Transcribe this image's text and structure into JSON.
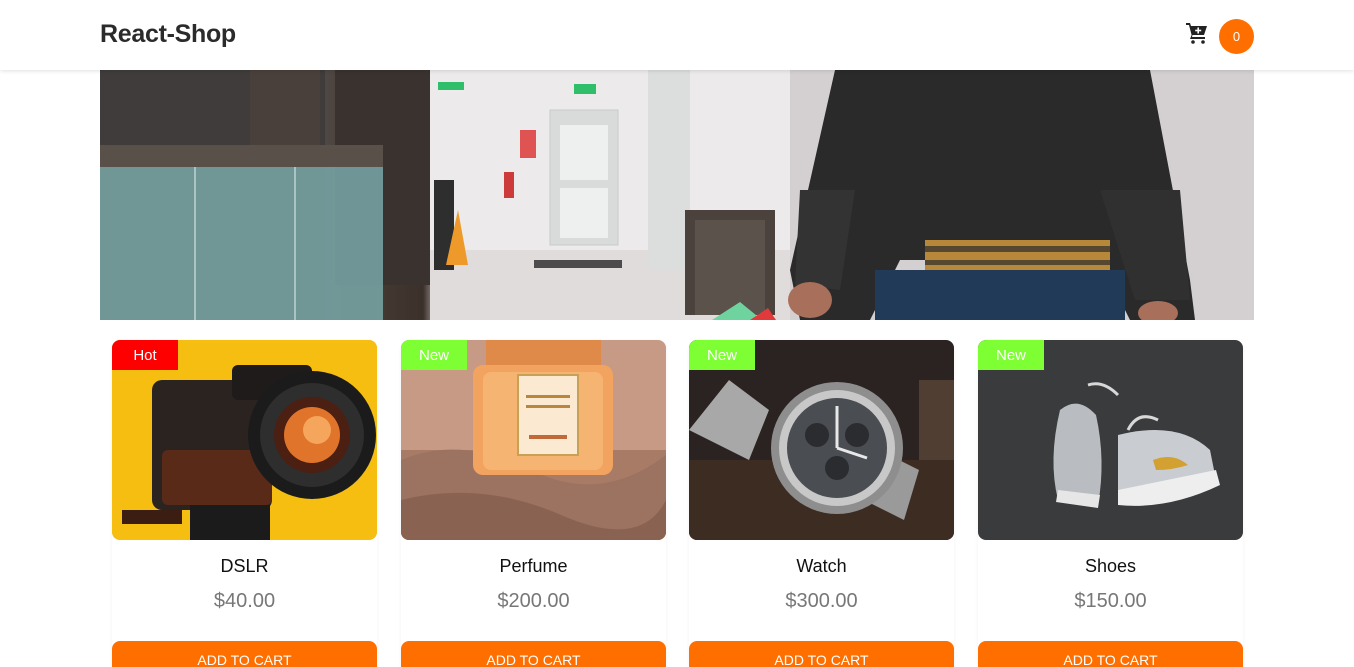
{
  "header": {
    "brand": "React-Shop",
    "cart_count": "0"
  },
  "hero": {
    "image": "shopper-in-hallway-with-bags"
  },
  "products": [
    {
      "name": "DSLR",
      "price": "$40.00",
      "tag": "Hot",
      "button_label": "ADD TO CART",
      "image": "dslr-camera"
    },
    {
      "name": "Perfume",
      "price": "$200.00",
      "tag": "New",
      "button_label": "ADD TO CART",
      "image": "perfume-bottle"
    },
    {
      "name": "Watch",
      "price": "$300.00",
      "tag": "New",
      "button_label": "ADD TO CART",
      "image": "wrist-watch"
    },
    {
      "name": "Shoes",
      "price": "$150.00",
      "tag": "New",
      "button_label": "ADD TO CART",
      "image": "sneakers"
    }
  ],
  "colors": {
    "accent": "#ff6f00",
    "hot_tag": "#ff0000",
    "new_tag": "#7dff33"
  }
}
